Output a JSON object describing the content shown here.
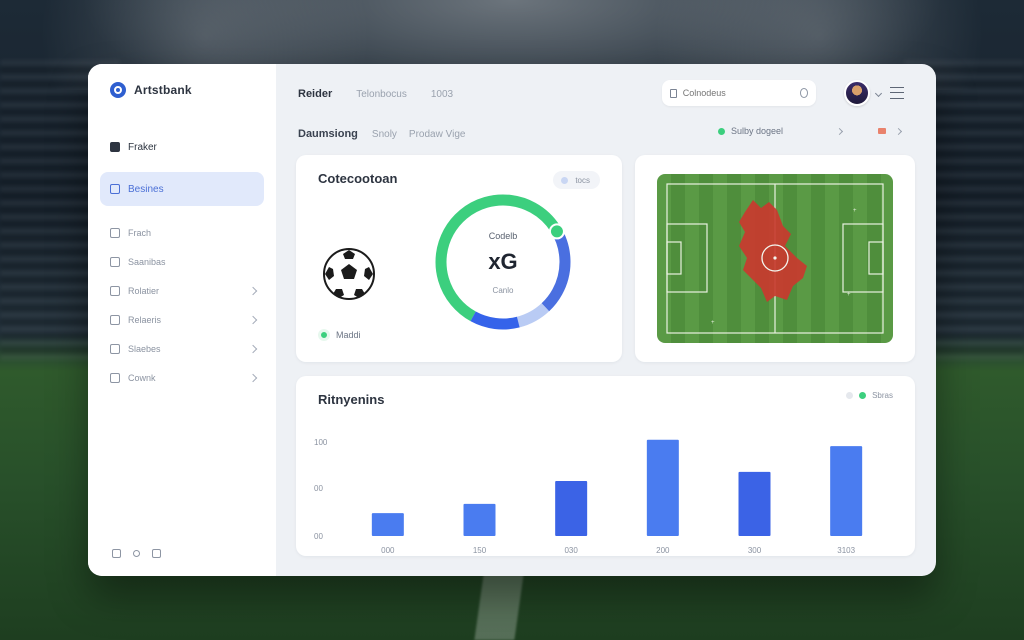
{
  "app": {
    "name": "Artstbank"
  },
  "sidebar": {
    "items": [
      {
        "label": "Fraker",
        "style": "top"
      },
      {
        "label": "Besines",
        "style": "active"
      },
      {
        "label": "Frach",
        "style": "small"
      },
      {
        "label": "Saanibas",
        "style": "small"
      },
      {
        "label": "Rolatier",
        "style": "small",
        "chevron": true
      },
      {
        "label": "Relaeris",
        "style": "small",
        "chevron": true
      },
      {
        "label": "Slaebes",
        "style": "small",
        "chevron": true
      },
      {
        "label": "Cownk",
        "style": "small",
        "chevron": true
      }
    ]
  },
  "topbar": {
    "tabs": [
      "Reider",
      "Telonbocus",
      "1003"
    ],
    "search_placeholder": "Colnodeus",
    "search_icon": "search-icon",
    "avatar_icon": "user-avatar"
  },
  "subbar": {
    "crumbs": [
      "Daumsiong",
      "Snoly",
      "Prodaw Vige"
    ],
    "status_label": "Sulby dogeel",
    "status_color": "#3ccf7e",
    "alert_color": "#e9826c"
  },
  "xg_card": {
    "title": "Cotecootoan",
    "pill": "tocs",
    "label_top": "Codelb",
    "center": "xG",
    "label_bottom": "Canlo",
    "legend": "Maddi",
    "ring_segments": [
      {
        "color": "#3ccf7e",
        "value": 0.58
      },
      {
        "color": "#4a6fe0",
        "value": 0.22
      },
      {
        "color": "#b9cbf4",
        "value": 0.08
      },
      {
        "color": "#3563ea",
        "value": 0.12
      }
    ]
  },
  "bars_card": {
    "title": "Ritnyenins",
    "legend": "Sbras"
  },
  "chart_data": {
    "type": "bar",
    "title": "Ritnyenins",
    "categories": [
      "000",
      "150",
      "030",
      "200",
      "300",
      "3103"
    ],
    "values": [
      25,
      35,
      60,
      105,
      70,
      98
    ],
    "y_ticks": [
      "00",
      "00",
      "100"
    ],
    "y_tick_values": [
      0,
      50,
      100
    ],
    "ylim": [
      0,
      120
    ],
    "colors": [
      "#4a7cf0",
      "#4a7cf0",
      "#3b63e6",
      "#4a7cf0",
      "#3b63e6",
      "#4a7cf0"
    ],
    "grid": false
  }
}
